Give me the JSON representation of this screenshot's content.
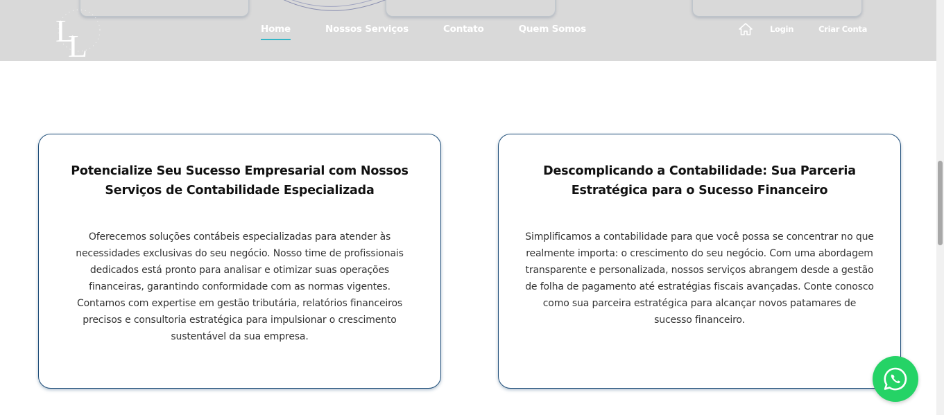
{
  "header": {
    "logo_text": "LL",
    "nav": [
      {
        "label": "Home",
        "active": true
      },
      {
        "label": "Nossos Serviços",
        "active": false
      },
      {
        "label": "Contato",
        "active": false
      },
      {
        "label": "Quem Somos",
        "active": false
      }
    ],
    "home_icon": "home-icon",
    "login_label": "Login",
    "signup_label": "Criar Conta"
  },
  "cards": [
    {
      "title": "Potencialize Seu Sucesso Empresarial com Nossos Serviços de Contabilidade Especializada",
      "body": "Oferecemos soluções contábeis especializadas para atender às necessidades exclusivas do seu negócio. Nosso time de profissionais dedicados está pronto para analisar e otimizar suas operações financeiras, garantindo conformidade com as normas vigentes. Contamos com expertise em gestão tributária, relatórios financeiros precisos e consultoria estratégica para impulsionar o crescimento sustentável da sua empresa."
    },
    {
      "title": "Descomplicando a Contabilidade: Sua Parceria Estratégica para o Sucesso Financeiro",
      "body": "Simplificamos a contabilidade para que você possa se concentrar no que realmente importa: o crescimento do seu negócio. Com uma abordagem transparente e personalizada, nossos serviços abrangem desde a gestão de folha de pagamento até estratégias fiscais avançadas. Conte conosco como sua parceira estratégica para alcançar novos patamares de sucesso financeiro."
    }
  ],
  "whatsapp_icon": "whatsapp-icon",
  "colors": {
    "header_bg": "#d9d9d9",
    "nav_active_underline": "#35b6c7",
    "card_border": "#1f4e79",
    "whatsapp": "#25d366"
  }
}
